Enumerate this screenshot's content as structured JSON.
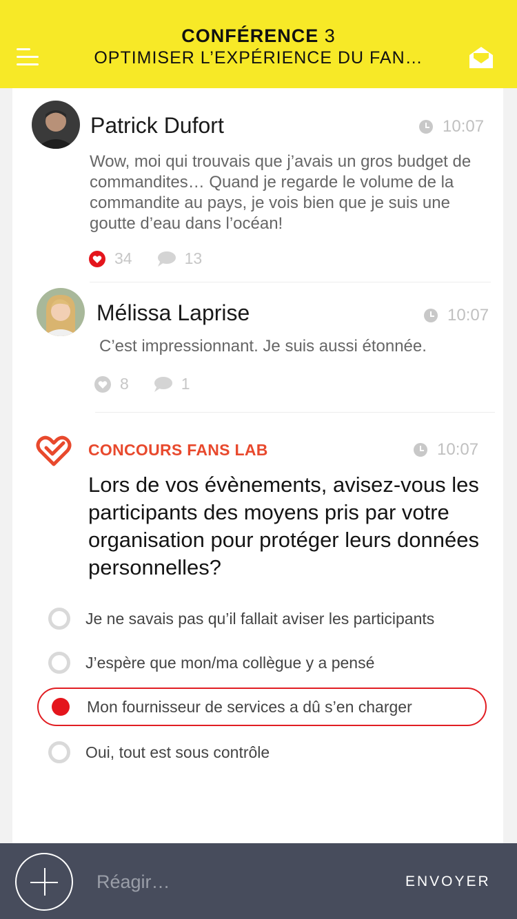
{
  "header": {
    "title_bold": "CONFÉRENCE",
    "title_number": "3",
    "subtitle": "OPTIMISER L’EXPÉRIENCE DU FAN…",
    "menu_icon": "hamburger-menu-icon",
    "mail_icon": "open-envelope-icon",
    "background_color": "#f7e927"
  },
  "posts": [
    {
      "author": "Patrick Dufort",
      "time": "10:07",
      "text": "Wow, moi qui trouvais que j’avais un gros budget de commandites… Quand je regarde le volume de la commandite au pays, je vois bien que je suis une goutte d’eau dans l’océan!",
      "likes": "34",
      "comments": "13",
      "liked": true
    },
    {
      "author": "Mélissa Laprise",
      "time": "10:07",
      "text": "C’est impressionnant. Je suis aussi étonnée.",
      "likes": "8",
      "comments": "1",
      "liked": false
    }
  ],
  "contest": {
    "label": "CONCOURS FANS LAB",
    "time": "10:07",
    "question": "Lors de vos évènements, avisez-vous les participants des moyens pris par votre organisation pour protéger leurs données personnelles?",
    "options": [
      {
        "label": "Je ne savais pas qu’il fallait aviser les participants",
        "selected": false
      },
      {
        "label": "J’espère que mon/ma collègue y a pensé",
        "selected": false
      },
      {
        "label": "Mon fournisseur de services a dû s’en charger",
        "selected": true
      },
      {
        "label": "Oui, tout est sous contrôle",
        "selected": false
      }
    ],
    "accent_color": "#e8492d"
  },
  "composer": {
    "placeholder": "Réagir…",
    "send_label": "ENVOYER",
    "background_color": "#474c5c"
  }
}
